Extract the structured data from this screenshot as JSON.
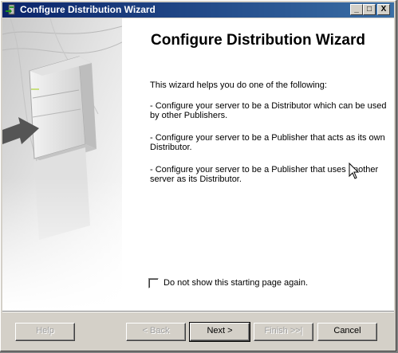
{
  "window": {
    "title": "Configure Distribution Wizard"
  },
  "titlebar_buttons": {
    "minimize": "_",
    "maximize": "□",
    "close": "X"
  },
  "page": {
    "heading": "Configure Distribution Wizard",
    "intro": "This wizard helps you do one of the following:",
    "options": [
      "- Configure your server to be a Distributor which can be used by other Publishers.",
      "- Configure your server to be a Publisher that acts as its own Distributor.",
      "- Configure your server to be a Publisher that uses another server as its Distributor."
    ],
    "checkbox_label": "Do not show this starting page again.",
    "checkbox_checked": false
  },
  "buttons": {
    "help": "Help",
    "back": "< Back",
    "next": "Next >",
    "finish": "Finish >>|",
    "cancel": "Cancel"
  },
  "colors": {
    "titlebar_start": "#0a246a",
    "titlebar_end": "#3a6ea5",
    "face": "#d4d0c8"
  }
}
